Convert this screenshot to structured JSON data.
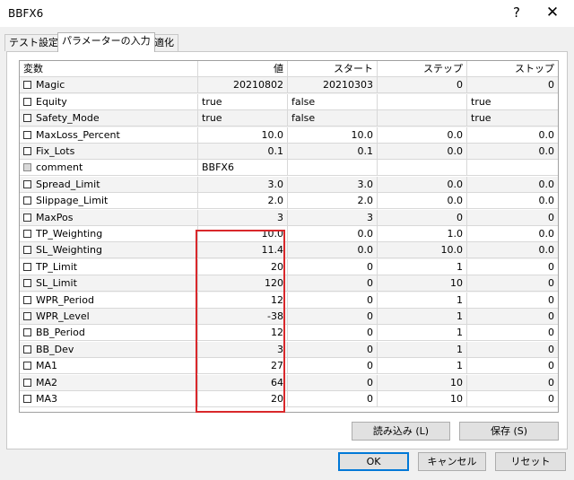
{
  "window": {
    "title": "BBFX6",
    "help": "?",
    "close": "✕"
  },
  "tabs": [
    {
      "label": "テスト設定"
    },
    {
      "label": "パラメーターの入力"
    },
    {
      "label": "最適化"
    }
  ],
  "grid": {
    "headers": [
      "変数",
      "値",
      "スタート",
      "ステップ",
      "ストップ"
    ],
    "rows": [
      {
        "name": "Magic",
        "value": "20210802",
        "start": "20210303",
        "step": "0",
        "stop": "0",
        "kind": "num",
        "checkbox": "on"
      },
      {
        "name": "Equity",
        "value": "true",
        "start": "false",
        "step": "",
        "stop": "true",
        "kind": "bool",
        "checkbox": "on"
      },
      {
        "name": "Safety_Mode",
        "value": "true",
        "start": "false",
        "step": "",
        "stop": "true",
        "kind": "bool",
        "checkbox": "on"
      },
      {
        "name": "MaxLoss_Percent",
        "value": "10.0",
        "start": "10.0",
        "step": "0.0",
        "stop": "0.0",
        "kind": "num",
        "checkbox": "on"
      },
      {
        "name": "Fix_Lots",
        "value": "0.1",
        "start": "0.1",
        "step": "0.0",
        "stop": "0.0",
        "kind": "num",
        "checkbox": "on"
      },
      {
        "name": "comment",
        "value": "BBFX6",
        "start": "",
        "step": "",
        "stop": "",
        "kind": "str",
        "checkbox": "disabled"
      },
      {
        "name": "Spread_Limit",
        "value": "3.0",
        "start": "3.0",
        "step": "0.0",
        "stop": "0.0",
        "kind": "num",
        "checkbox": "on"
      },
      {
        "name": "Slippage_Limit",
        "value": "2.0",
        "start": "2.0",
        "step": "0.0",
        "stop": "0.0",
        "kind": "num",
        "checkbox": "on"
      },
      {
        "name": "MaxPos",
        "value": "3",
        "start": "3",
        "step": "0",
        "stop": "0",
        "kind": "num",
        "checkbox": "on"
      },
      {
        "name": "TP_Weighting",
        "value": "10.0",
        "start": "0.0",
        "step": "1.0",
        "stop": "0.0",
        "kind": "num",
        "checkbox": "on"
      },
      {
        "name": "SL_Weighting",
        "value": "11.4",
        "start": "0.0",
        "step": "10.0",
        "stop": "0.0",
        "kind": "num",
        "checkbox": "on"
      },
      {
        "name": "TP_Limit",
        "value": "20",
        "start": "0",
        "step": "1",
        "stop": "0",
        "kind": "num",
        "checkbox": "on"
      },
      {
        "name": "SL_Limit",
        "value": "120",
        "start": "0",
        "step": "10",
        "stop": "0",
        "kind": "num",
        "checkbox": "on"
      },
      {
        "name": "WPR_Period",
        "value": "12",
        "start": "0",
        "step": "1",
        "stop": "0",
        "kind": "num",
        "checkbox": "on"
      },
      {
        "name": "WPR_Level",
        "value": "-38",
        "start": "0",
        "step": "1",
        "stop": "0",
        "kind": "num",
        "checkbox": "on"
      },
      {
        "name": "BB_Period",
        "value": "12",
        "start": "0",
        "step": "1",
        "stop": "0",
        "kind": "num",
        "checkbox": "on"
      },
      {
        "name": "BB_Dev",
        "value": "3",
        "start": "0",
        "step": "1",
        "stop": "0",
        "kind": "num",
        "checkbox": "on"
      },
      {
        "name": "MA1",
        "value": "27",
        "start": "0",
        "step": "1",
        "stop": "0",
        "kind": "num",
        "checkbox": "on"
      },
      {
        "name": "MA2",
        "value": "64",
        "start": "0",
        "step": "10",
        "stop": "0",
        "kind": "num",
        "checkbox": "on"
      },
      {
        "name": "MA3",
        "value": "20",
        "start": "0",
        "step": "10",
        "stop": "0",
        "kind": "num",
        "checkbox": "on"
      }
    ]
  },
  "buttons": {
    "load": "読み込み (L)",
    "save": "保存 (S)",
    "ok": "OK",
    "cancel": "キャンセル",
    "reset": "リセット"
  },
  "colors": {
    "highlight": "#d9282b",
    "accent": "#0078d7"
  }
}
